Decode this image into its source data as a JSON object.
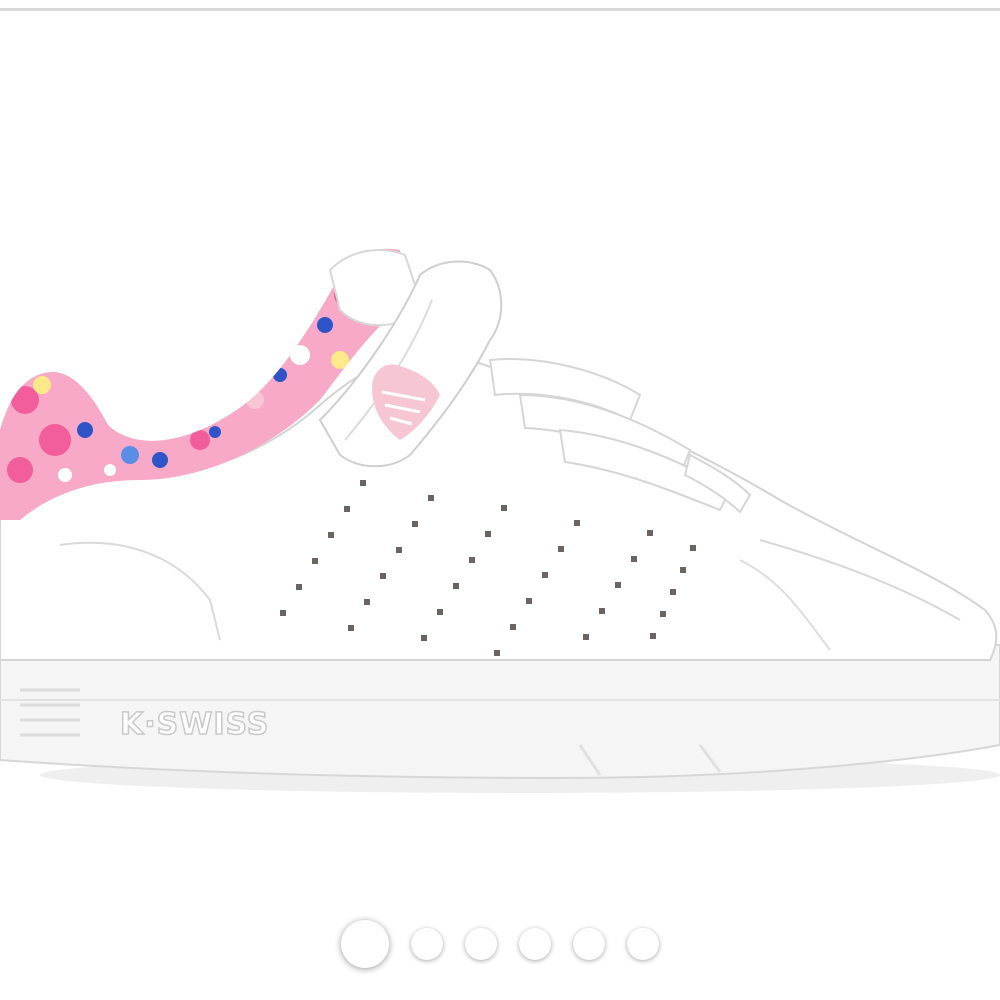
{
  "product_image": {
    "brand_text": "K·SWISS",
    "colors": {
      "upper": "#ffffff",
      "sole": "#f4f4f4",
      "collar_pink": "#f25d9c",
      "collar_blue": "#2f54c8",
      "heel_tab_pink": "#f7c6d3",
      "perforation": "#6b6460"
    }
  },
  "carousel": {
    "total_slides": 6,
    "active_index": 0
  }
}
